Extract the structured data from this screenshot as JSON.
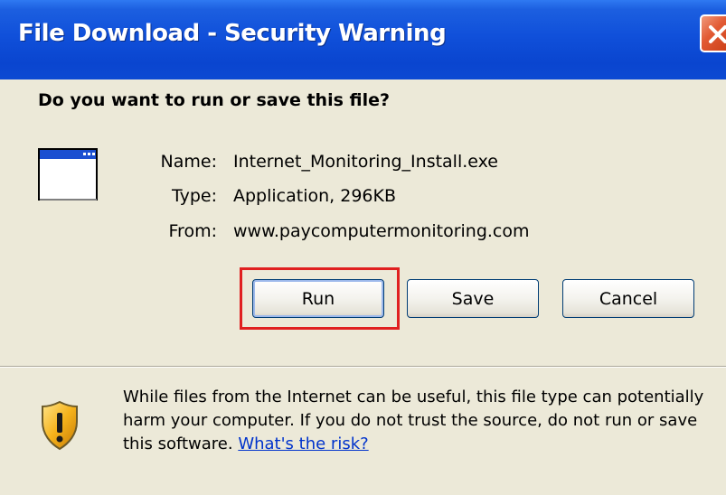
{
  "window": {
    "title": "File Download - Security Warning",
    "title_bar_color": "#0A45CF",
    "close_icon": "close-icon"
  },
  "dialog": {
    "question": "Do you want to run or save this file?",
    "file_icon": "application-window-icon",
    "fields": [
      {
        "label": "Name:",
        "value": "Internet_Monitoring_Install.exe"
      },
      {
        "label": "Type:",
        "value": "Application, 296KB"
      },
      {
        "label": "From:",
        "value": "www.paycomputermonitoring.com"
      }
    ],
    "buttons": {
      "run": "Run",
      "save": "Save",
      "cancel": "Cancel"
    },
    "highlight_color": "#E02020"
  },
  "warning": {
    "icon": "shield-warning-icon",
    "text": "While files from the Internet can be useful, this file type can potentially harm your computer. If you do not trust the source, do not run or save this software. ",
    "link": "What's the risk?"
  }
}
